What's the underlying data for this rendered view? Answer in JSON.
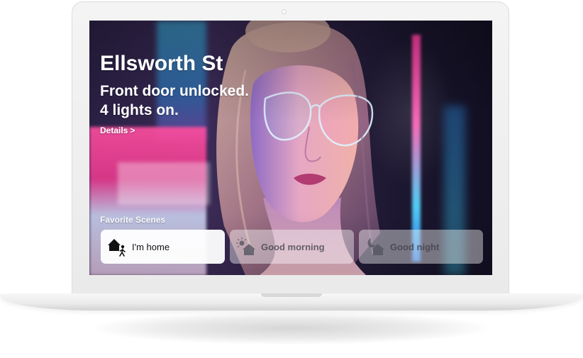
{
  "home": {
    "name": "Ellsworth St",
    "status_lines": [
      "Front door unlocked.",
      "4 lights on."
    ],
    "details_label": "Details",
    "details_chevron": ">"
  },
  "scenes": {
    "section_label": "Favorite Scenes",
    "items": [
      {
        "label": "I'm home",
        "icon": "arrive-home-icon",
        "active": true
      },
      {
        "label": "Good morning",
        "icon": "sunrise-home-icon",
        "active": false
      },
      {
        "label": "Good night",
        "icon": "moon-home-icon",
        "active": false
      }
    ]
  },
  "colors": {
    "accent_pink": "#ff4fa0",
    "accent_cyan": "#3bd2ff",
    "tile_active": "#ffffff",
    "text_primary": "#ffffff"
  }
}
